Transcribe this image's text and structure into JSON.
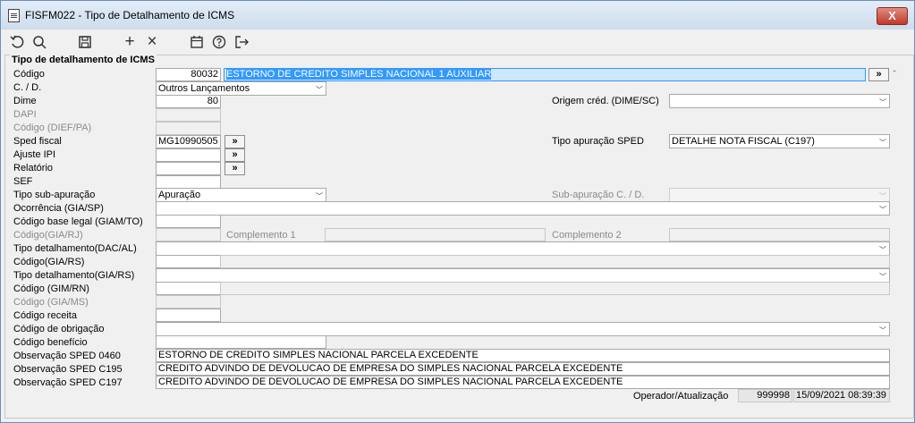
{
  "window": {
    "title": "FISFM022 - Tipo de Detalhamento de ICMS",
    "close_label": "X"
  },
  "toolbar": {
    "icons": [
      "undo-icon",
      "search-icon",
      "save-icon",
      "add-icon",
      "delete-icon",
      "calendar-icon",
      "help-icon",
      "exit-icon"
    ],
    "add_label": "+",
    "delete_label": "×"
  },
  "form": {
    "section_title": "Tipo de detalhamento de ICMS",
    "codigo": {
      "label": "Código",
      "value": "80032",
      "description": "ESTORNO DE CREDITO SIMPLES NACIONAL 1 AUXILIAR",
      "button": "»"
    },
    "cd": {
      "label": "C. / D.",
      "value": "Outros Lançamentos"
    },
    "dime": {
      "label": "Dime",
      "value": "80"
    },
    "origem_cred": {
      "label": "Origem créd. (DIME/SC)",
      "value": ""
    },
    "dapi": {
      "label": "DAPI",
      "value": ""
    },
    "codigo_dief": {
      "label": "Código (DIEF/PA)",
      "value": ""
    },
    "sped_fiscal": {
      "label": "Sped fiscal",
      "value": "MG10990505",
      "button": "»"
    },
    "tipo_apuracao_sped": {
      "label": "Tipo apuração SPED",
      "value": "DETALHE NOTA FISCAL (C197)"
    },
    "ajuste_ipi": {
      "label": "Ajuste IPI",
      "value": "",
      "button": "»"
    },
    "relatorio": {
      "label": "Relatório",
      "value": "",
      "button": "»"
    },
    "sef": {
      "label": "SEF",
      "value": ""
    },
    "tipo_sub_apuracao": {
      "label": "Tipo sub-apuração",
      "value": "Apuração"
    },
    "sub_apuracao_cd": {
      "label": "Sub-apuração C. / D.",
      "value": ""
    },
    "ocorrencia": {
      "label": "Ocorrência (GIA/SP)",
      "value": ""
    },
    "codigo_base_legal": {
      "label": "Código base legal (GIAM/TO)",
      "value": ""
    },
    "codigo_gia_rj": {
      "label": "Código(GIA/RJ)",
      "value": ""
    },
    "complemento1": {
      "label": "Complemento 1",
      "value": ""
    },
    "complemento2": {
      "label": "Complemento 2",
      "value": ""
    },
    "tipo_det_dac": {
      "label": "Tipo detalhamento(DAC/AL)",
      "value": ""
    },
    "codigo_gia_rs": {
      "label": "Código(GIA/RS)",
      "value": ""
    },
    "tipo_det_gia_rs": {
      "label": "Tipo detalhamento(GIA/RS)",
      "value": ""
    },
    "codigo_gim_rn": {
      "label": "Código (GIM/RN)",
      "value": ""
    },
    "codigo_gia_ms": {
      "label": "Código (GIA/MS)",
      "value": ""
    },
    "codigo_receita": {
      "label": "Código receita",
      "value": ""
    },
    "codigo_obrigacao": {
      "label": "Código de obrigação",
      "value": ""
    },
    "codigo_beneficio": {
      "label": "Código benefício",
      "value": ""
    },
    "obs_0460": {
      "label": "Observação SPED 0460",
      "value": "ESTORNO DE CREDITO SIMPLES NACIONAL PARCELA EXCEDENTE"
    },
    "obs_c195": {
      "label": "Observação SPED C195",
      "value": "CREDITO ADVINDO DE DEVOLUCAO DE EMPRESA DO SIMPLES NACIONAL PARCELA EXCEDENTE"
    },
    "obs_c197": {
      "label": "Observação SPED C197",
      "value": "CREDITO ADVINDO DE DEVOLUCAO DE EMPRESA DO SIMPLES NACIONAL PARCELA EXCEDENTE"
    },
    "operador": {
      "label": "Operador/Atualização",
      "user": "999998",
      "timestamp": "15/09/2021 08:39:39"
    }
  }
}
